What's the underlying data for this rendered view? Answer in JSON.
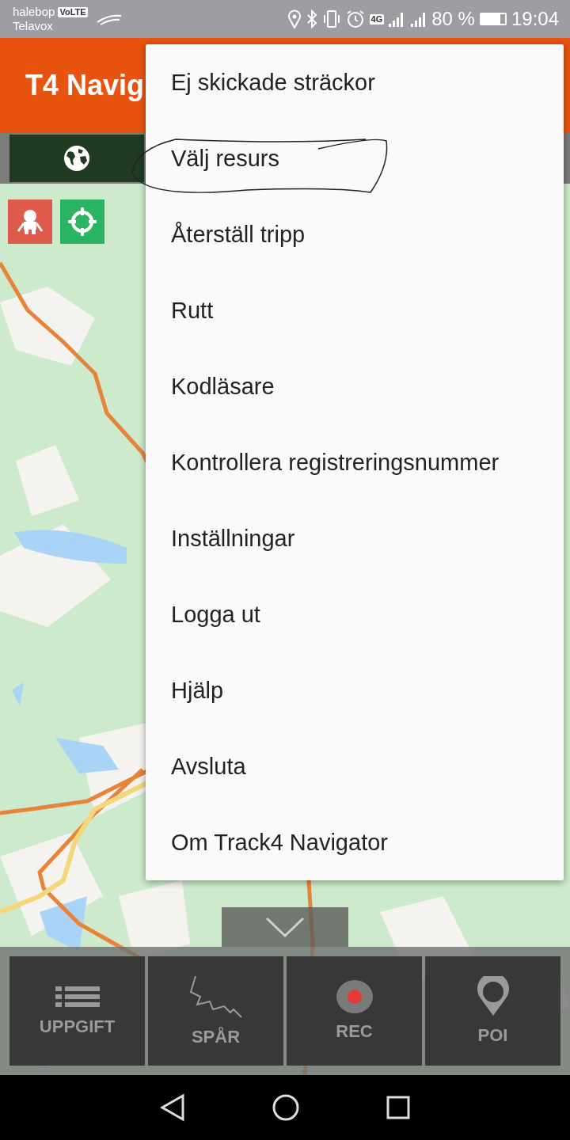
{
  "status_bar": {
    "carrier": "halebop",
    "badge": "VoLTE",
    "carrier_2": "Telavox",
    "network": "4G",
    "battery": "80 %",
    "time": "19:04"
  },
  "app_bar": {
    "title": "T4 Navig"
  },
  "menu": {
    "items": [
      {
        "label": "Ej skickade sträckor",
        "circled": false
      },
      {
        "label": "Välj resurs",
        "circled": true
      },
      {
        "label": "Återställ tripp",
        "circled": false
      },
      {
        "label": "Rutt",
        "circled": false
      },
      {
        "label": "Kodläsare",
        "circled": false
      },
      {
        "label": "Kontrollera registreringsnummer",
        "circled": false
      },
      {
        "label": "Inställningar",
        "circled": false
      },
      {
        "label": "Logga ut",
        "circled": false
      },
      {
        "label": "Hjälp",
        "circled": false
      },
      {
        "label": "Avsluta",
        "circled": false
      },
      {
        "label": "Om Track4 Navigator",
        "circled": false
      }
    ]
  },
  "map_buttons": [
    {
      "kind": "robot"
    },
    {
      "kind": "locate"
    }
  ],
  "bottom_bar": {
    "buttons": [
      {
        "label": "UPPGIFT",
        "kind": "list"
      },
      {
        "label": "SPÅR",
        "kind": "track"
      },
      {
        "label": "REC",
        "kind": "rec"
      },
      {
        "label": "POI",
        "kind": "poi"
      }
    ]
  }
}
